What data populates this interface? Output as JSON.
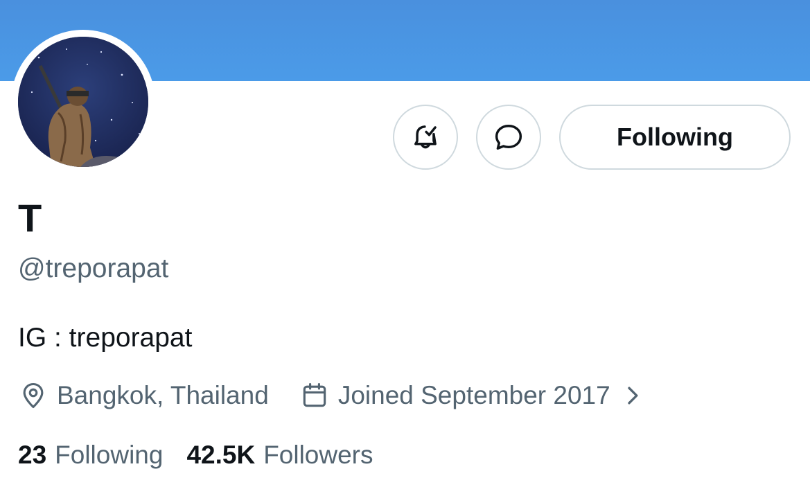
{
  "banner": {
    "color": "#4b9be8"
  },
  "avatar": {
    "alt": "profile photo"
  },
  "actions": {
    "notify_icon": "bell-check-icon",
    "message_icon": "message-bubble-icon",
    "follow_label": "Following"
  },
  "profile": {
    "name": "T",
    "handle": "@treporapat",
    "bio": "IG : treporapat",
    "location": "Bangkok, Thailand",
    "joined": "Joined September 2017"
  },
  "stats": {
    "following_count": "23",
    "following_label": "Following",
    "followers_count": "42.5K",
    "followers_label": "Followers"
  },
  "colors": {
    "text_primary": "#0f1419",
    "text_secondary": "#536471",
    "border": "#cfd9de"
  }
}
